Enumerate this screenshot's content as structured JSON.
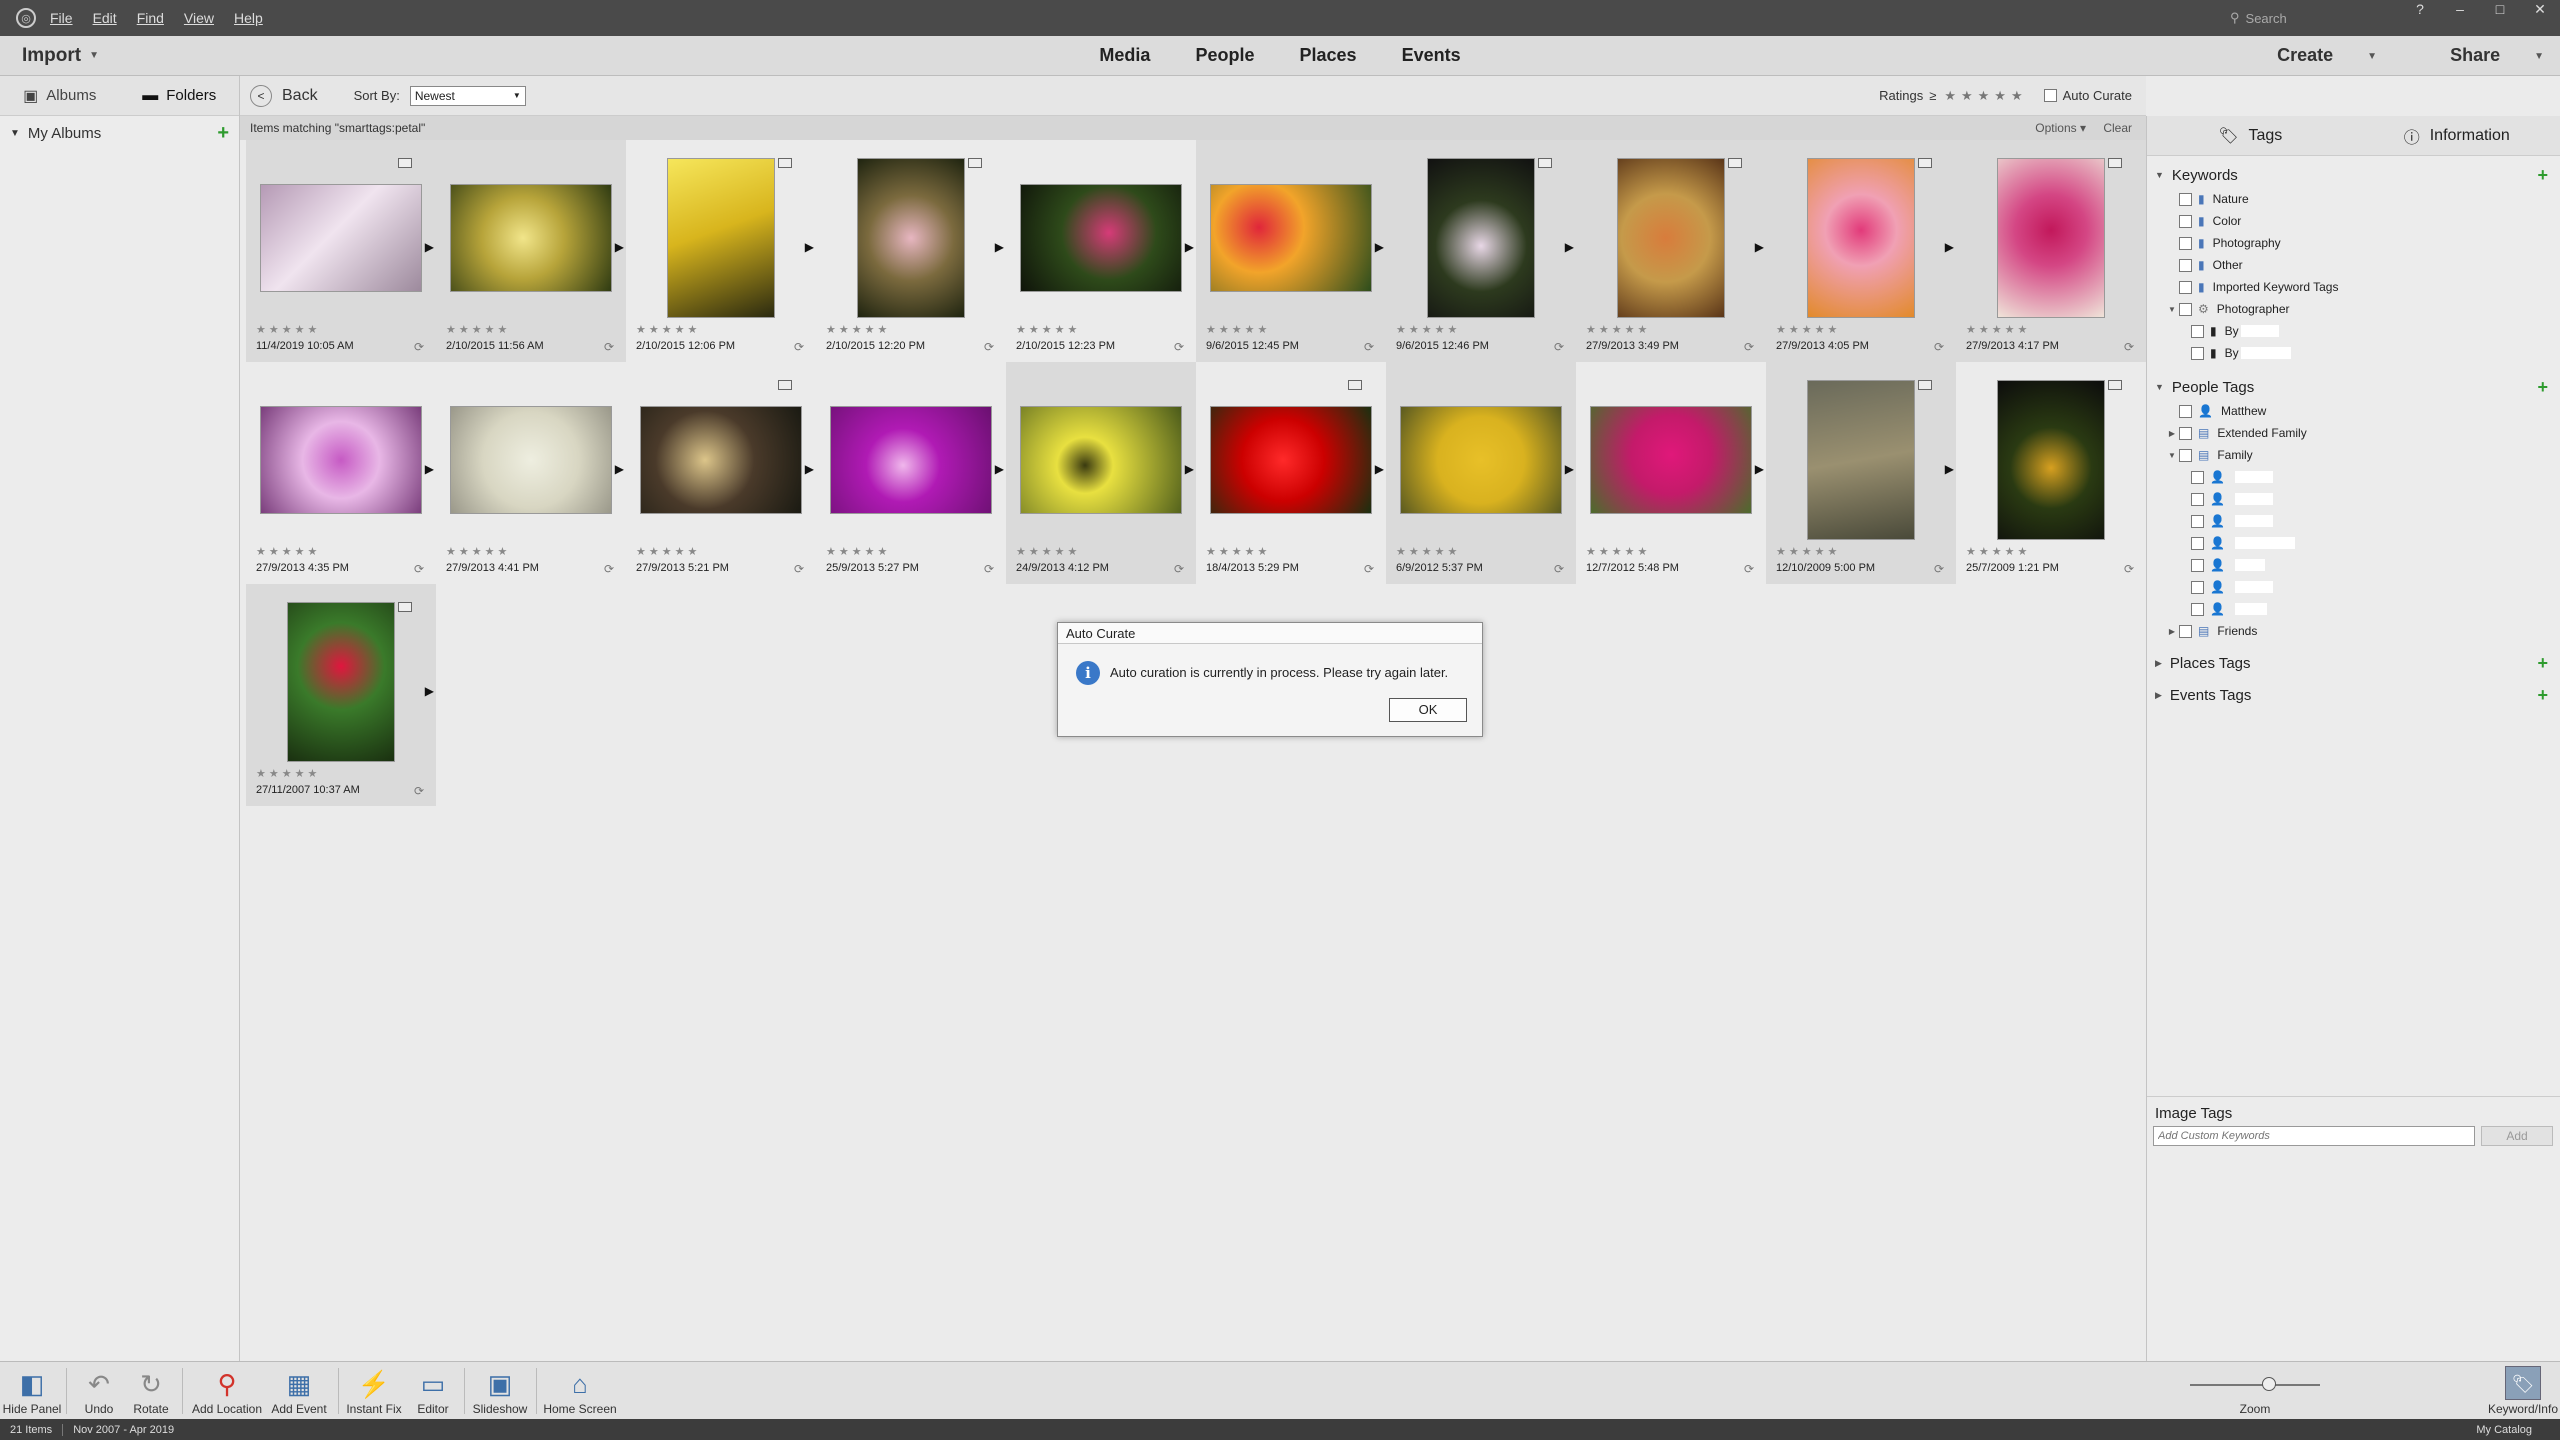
{
  "menubar": {
    "items": [
      "File",
      "Edit",
      "Find",
      "View",
      "Help"
    ],
    "search_placeholder": "Search"
  },
  "topbar": {
    "import_label": "Import",
    "nav": [
      "Media",
      "People",
      "Places",
      "Events"
    ],
    "create_label": "Create",
    "share_label": "Share"
  },
  "left_panel": {
    "tab_albums": "Albums",
    "tab_folders": "Folders",
    "my_albums": "My Albums"
  },
  "toolbar": {
    "back_label": "Back",
    "sort_label": "Sort By:",
    "sort_value": "Newest",
    "ratings_label": "Ratings",
    "ratings_op": "≥",
    "auto_curate_label": "Auto Curate"
  },
  "match_bar": {
    "text": "Items matching \"smarttags:petal\"",
    "options_label": "Options",
    "clear_label": "Clear"
  },
  "thumbnails": [
    {
      "date": "11/4/2019 10:05 AM"
    },
    {
      "date": "2/10/2015 11:56 AM"
    },
    {
      "date": "2/10/2015 12:06 PM"
    },
    {
      "date": "2/10/2015 12:20 PM"
    },
    {
      "date": "2/10/2015 12:23 PM"
    },
    {
      "date": "9/6/2015 12:45 PM"
    },
    {
      "date": "9/6/2015 12:46 PM"
    },
    {
      "date": "27/9/2013 3:49 PM"
    },
    {
      "date": "27/9/2013 4:05 PM"
    },
    {
      "date": "27/9/2013 4:17 PM"
    },
    {
      "date": "27/9/2013 4:35 PM"
    },
    {
      "date": "27/9/2013 4:41 PM"
    },
    {
      "date": "27/9/2013 5:21 PM"
    },
    {
      "date": "25/9/2013 5:27 PM"
    },
    {
      "date": "24/9/2013 4:12 PM"
    },
    {
      "date": "18/4/2013 5:29 PM"
    },
    {
      "date": "6/9/2012 5:37 PM"
    },
    {
      "date": "12/7/2012 5:48 PM"
    },
    {
      "date": "12/10/2009 5:00 PM"
    },
    {
      "date": "25/7/2009 1:21 PM"
    },
    {
      "date": "27/11/2007 10:37 AM"
    }
  ],
  "right_panel": {
    "tab_tags": "Tags",
    "tab_information": "Information",
    "keywords": {
      "label": "Keywords",
      "items": [
        "Nature",
        "Color",
        "Photography",
        "Other",
        "Imported Keyword Tags",
        "Photographer"
      ],
      "sub_items": [
        "By",
        "By"
      ]
    },
    "people_tags": {
      "label": "People Tags",
      "items": [
        "Matthew",
        "Extended Family",
        "Family"
      ],
      "friends": "Friends"
    },
    "places_tags": "Places Tags",
    "events_tags": "Events Tags",
    "image_tags": {
      "label": "Image Tags",
      "placeholder": "Add Custom Keywords",
      "add_label": "Add"
    }
  },
  "bottombar": {
    "buttons": [
      "Hide Panel",
      "Undo",
      "Rotate",
      "Add Location",
      "Add Event",
      "Instant Fix",
      "Editor",
      "Slideshow",
      "Home Screen"
    ],
    "zoom_label": "Zoom",
    "keyword_info_label": "Keyword/Info"
  },
  "statusbar": {
    "count": "21 Items",
    "range": "Nov 2007 - Apr 2019",
    "catalog": "My Catalog"
  },
  "dialog": {
    "title": "Auto Curate",
    "message": "Auto curation is currently in process. Please try again later.",
    "ok_label": "OK"
  }
}
